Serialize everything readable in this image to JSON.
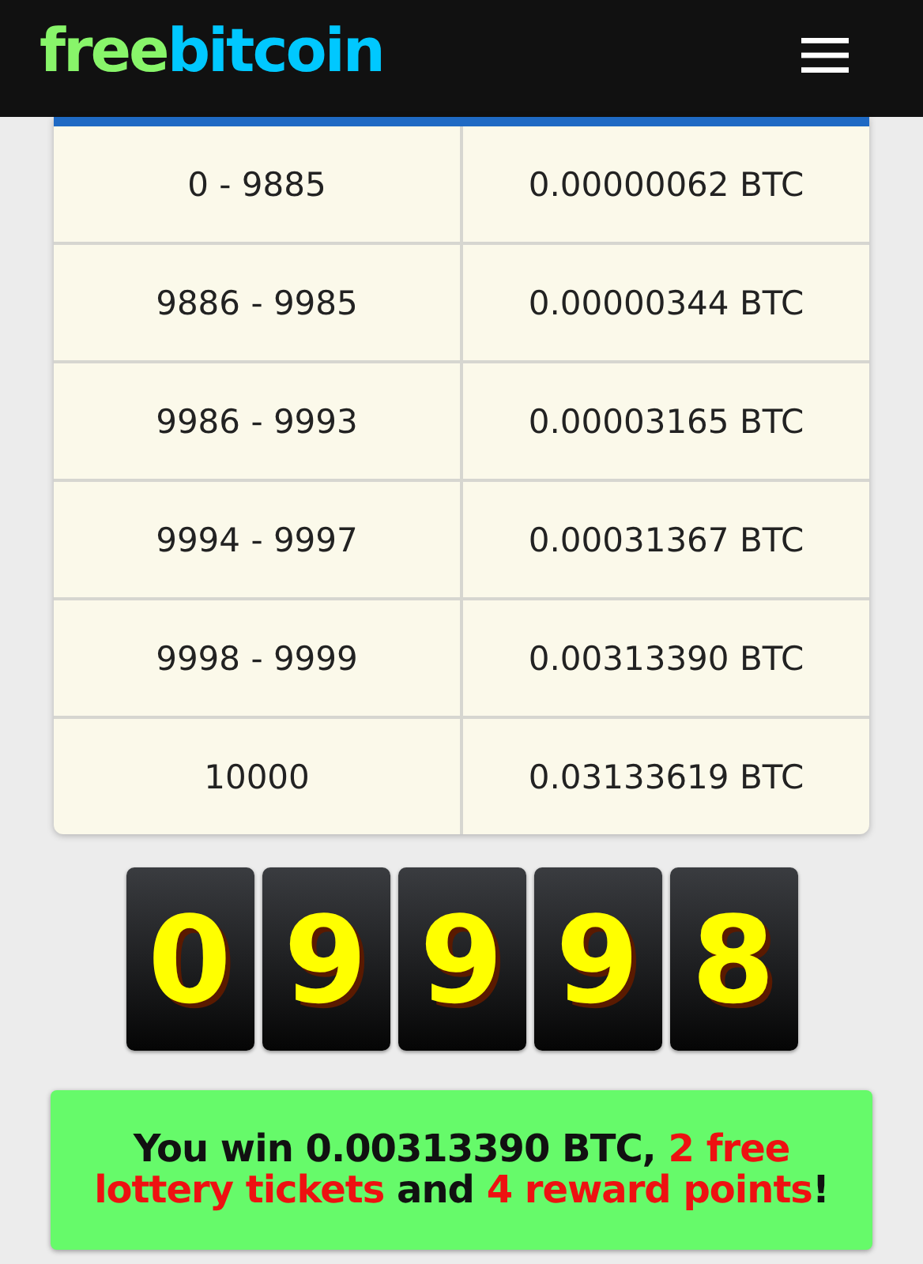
{
  "header": {
    "logo": [
      {
        "text": "free",
        "color": "#88f56a"
      },
      {
        "text": "bitcoin",
        "color": "#00c8ff"
      }
    ]
  },
  "payout_table": {
    "rows": [
      {
        "range": "0 - 9885",
        "prize": "0.00000062 BTC"
      },
      {
        "range": "9886 - 9985",
        "prize": "0.00000344 BTC"
      },
      {
        "range": "9986 - 9993",
        "prize": "0.00003165 BTC"
      },
      {
        "range": "9994 - 9997",
        "prize": "0.00031367 BTC"
      },
      {
        "range": "9998 - 9999",
        "prize": "0.00313390 BTC"
      },
      {
        "range": "10000",
        "prize": "0.03133619 BTC"
      }
    ]
  },
  "roll_digits": [
    "0",
    "9",
    "9",
    "9",
    "8"
  ],
  "result_message": [
    {
      "text": "You win 0.00313390 BTC, ",
      "highlight": false
    },
    {
      "text": "2 free lottery tickets",
      "highlight": true
    },
    {
      "text": " and ",
      "highlight": false
    },
    {
      "text": "4 reward points",
      "highlight": true
    },
    {
      "text": "!",
      "highlight": false
    }
  ]
}
